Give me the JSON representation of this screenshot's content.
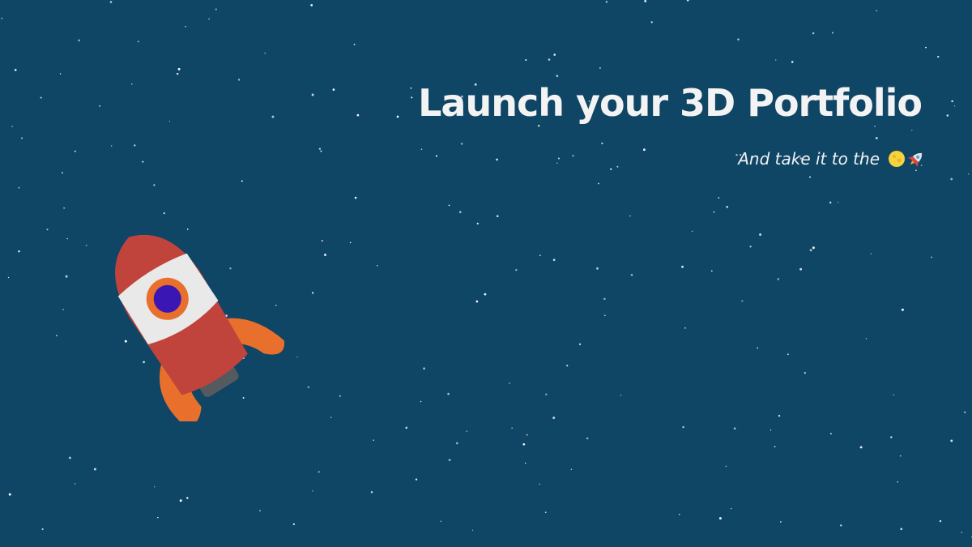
{
  "hero": {
    "title": "Launch your 3D Portfolio",
    "subtitle": "And take it to the",
    "subtitle_icons": [
      "moon-icon",
      "rocket-emoji-icon"
    ]
  },
  "theme": {
    "background": "#0f4565",
    "text": "#f3f3f3",
    "rocket_body": "#c0443c",
    "rocket_white": "#e9e9e9",
    "rocket_fins": "#e8702c",
    "window_glass": "#3a16b4"
  }
}
